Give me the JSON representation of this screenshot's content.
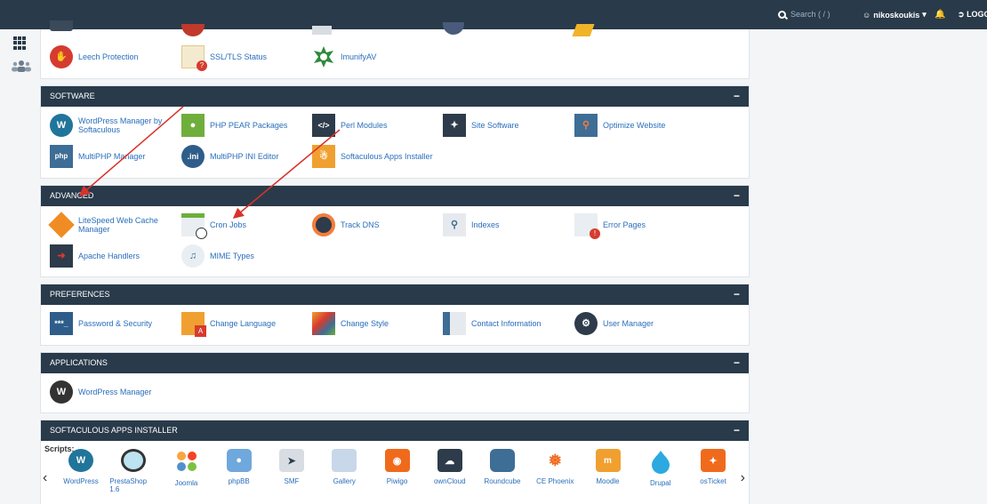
{
  "topbar": {
    "search_placeholder": "Search ( / )",
    "username": "nikoskoukis",
    "logout_label": "LOGOU"
  },
  "security": {
    "items": [
      {
        "label": "Leech Protection",
        "icon": "leech-protection-icon"
      },
      {
        "label": "SSL/TLS Status",
        "icon": "ssl-status-icon"
      },
      {
        "label": "ImunifyAV",
        "icon": "imunifyav-icon"
      }
    ]
  },
  "software": {
    "title": "SOFTWARE",
    "toggle": "−",
    "items": [
      {
        "label": "WordPress Manager by Softaculous",
        "icon": "wordpress-icon"
      },
      {
        "label": "PHP PEAR Packages",
        "icon": "php-pear-icon"
      },
      {
        "label": "Perl Modules",
        "icon": "perl-modules-icon"
      },
      {
        "label": "Site Software",
        "icon": "site-software-icon"
      },
      {
        "label": "Optimize Website",
        "icon": "optimize-website-icon"
      },
      {
        "label": "MultiPHP Manager",
        "icon": "multiphp-manager-icon"
      },
      {
        "label": "MultiPHP INI Editor",
        "icon": "multiphp-ini-icon"
      },
      {
        "label": "Softaculous Apps Installer",
        "icon": "softaculous-icon"
      }
    ]
  },
  "advanced": {
    "title": "ADVANCED",
    "toggle": "−",
    "items": [
      {
        "label": "LiteSpeed Web Cache Manager",
        "icon": "litespeed-icon"
      },
      {
        "label": "Cron Jobs",
        "icon": "cron-jobs-icon"
      },
      {
        "label": "Track DNS",
        "icon": "track-dns-icon"
      },
      {
        "label": "Indexes",
        "icon": "indexes-icon"
      },
      {
        "label": "Error Pages",
        "icon": "error-pages-icon"
      },
      {
        "label": "Apache Handlers",
        "icon": "apache-handlers-icon"
      },
      {
        "label": "MIME Types",
        "icon": "mime-types-icon"
      }
    ]
  },
  "preferences": {
    "title": "PREFERENCES",
    "toggle": "−",
    "items": [
      {
        "label": "Password & Security",
        "icon": "password-security-icon"
      },
      {
        "label": "Change Language",
        "icon": "change-language-icon"
      },
      {
        "label": "Change Style",
        "icon": "change-style-icon"
      },
      {
        "label": "Contact Information",
        "icon": "contact-information-icon"
      },
      {
        "label": "User Manager",
        "icon": "user-manager-icon"
      }
    ]
  },
  "applications": {
    "title": "APPLICATIONS",
    "toggle": "−",
    "items": [
      {
        "label": "WordPress Manager",
        "icon": "wordpress-icon"
      }
    ]
  },
  "softaculous": {
    "title": "SOFTACULOUS APPS INSTALLER",
    "toggle": "−",
    "scripts_label": "Scripts:",
    "prev": "‹",
    "next": "›",
    "apps": [
      "WordPress",
      "PrestaShop 1.6",
      "Joomla",
      "phpBB",
      "SMF",
      "Gallery",
      "Piwigo",
      "ownCloud",
      "Roundcube",
      "CE Phoenix",
      "Moodle",
      "Drupal",
      "osTicket"
    ]
  },
  "colors": {
    "header_bg": "#293a4a",
    "link": "#2a6ebb",
    "annotation_arrow": "#d9322b"
  }
}
